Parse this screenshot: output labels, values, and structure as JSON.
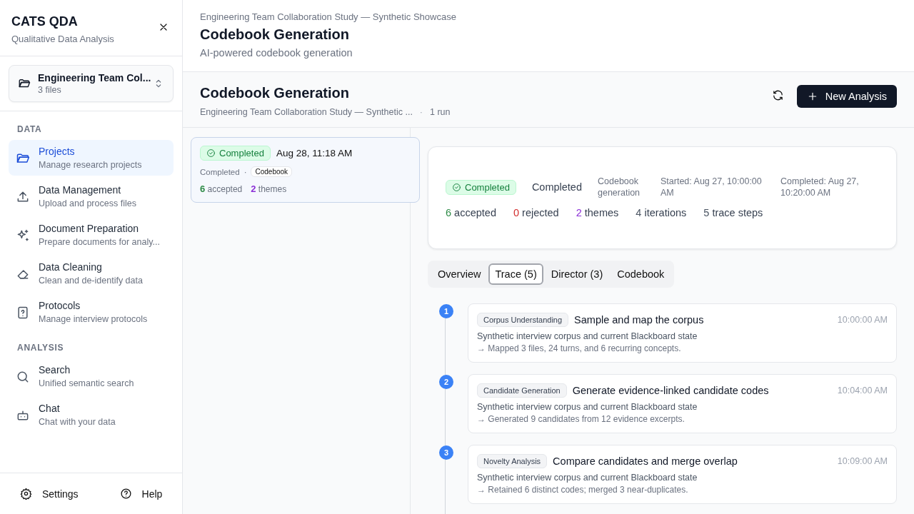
{
  "sidebar": {
    "app_title": "CATS QDA",
    "app_subtitle": "Qualitative Data Analysis",
    "project_picker": {
      "name": "Engineering Team Col...",
      "files": "3 files"
    },
    "sections": [
      {
        "heading": "DATA",
        "items": [
          {
            "label": "Projects",
            "description": "Manage research projects",
            "selected": true
          },
          {
            "label": "Data Management",
            "description": "Upload and process files",
            "selected": false
          },
          {
            "label": "Document Preparation",
            "description": "Prepare documents for analy...",
            "selected": false
          },
          {
            "label": "Data Cleaning",
            "description": "Clean and de-identify data",
            "selected": false
          },
          {
            "label": "Protocols",
            "description": "Manage interview protocols",
            "selected": false
          }
        ]
      },
      {
        "heading": "ANALYSIS",
        "items": [
          {
            "label": "Search",
            "description": "Unified semantic search",
            "selected": false
          },
          {
            "label": "Chat",
            "description": "Chat with your data",
            "selected": false
          }
        ]
      }
    ],
    "footer": [
      {
        "label": "Settings"
      },
      {
        "label": "Help"
      }
    ]
  },
  "header": {
    "breadcrumb": "Engineering Team Collaboration Study — Synthetic Showcase",
    "title": "Codebook Generation",
    "subtitle": "AI-powered codebook generation"
  },
  "toolbar": {
    "title": "Codebook Generation",
    "project": "Engineering Team Collaboration Study — Synthetic ...",
    "separator": "·",
    "runs": "1 run",
    "new_button": "New Analysis"
  },
  "runs": [
    {
      "status": "Completed",
      "date": "Aug 28, 11:18 AM",
      "state": "Completed",
      "separator": "·",
      "tag": "Codebook",
      "selected": true,
      "stats": [
        {
          "count": "6",
          "label": "accepted",
          "color": "#2e8b47"
        },
        {
          "count": "2",
          "label": "themes",
          "color": "#8b2fd6"
        }
      ]
    }
  ],
  "summary": {
    "status": "Completed",
    "state": "Completed",
    "kind_label": "Codebook generation",
    "started": "Started: Aug 27, 10:00:00 AM",
    "completed": "Completed: Aug 27, 10:20:00 AM",
    "stats": [
      {
        "count": "6",
        "label": "accepted",
        "color": "#2e8b47"
      },
      {
        "count": "0",
        "label": "rejected",
        "color": "#d32f2f"
      },
      {
        "count": "2",
        "label": "themes",
        "color": "#8b2fd6"
      },
      {
        "count": "4",
        "label": "iterations",
        "color": "#4b5563"
      },
      {
        "count": "5",
        "label": "trace steps",
        "color": "#4b5563"
      }
    ]
  },
  "tabs": [
    {
      "label": "Overview",
      "selected": false
    },
    {
      "label": "Trace (5)",
      "selected": true
    },
    {
      "label": "Director (3)",
      "selected": false
    },
    {
      "label": "Codebook",
      "selected": false
    }
  ],
  "trace": [
    {
      "number": "1",
      "phase": "Corpus Understanding",
      "title": "Sample and map the corpus",
      "time": "10:00:00 AM",
      "input": "Synthetic interview corpus and current Blackboard state",
      "output": "→ Mapped 3 files, 24 turns, and 6 recurring concepts."
    },
    {
      "number": "2",
      "phase": "Candidate Generation",
      "title": "Generate evidence-linked candidate codes",
      "time": "10:04:00 AM",
      "input": "Synthetic interview corpus and current Blackboard state",
      "output": "→ Generated 9 candidates from 12 evidence excerpts."
    },
    {
      "number": "3",
      "phase": "Novelty Analysis",
      "title": "Compare candidates and merge overlap",
      "time": "10:09:00 AM",
      "input": "Synthetic interview corpus and current Blackboard state",
      "output": "→ Retained 6 distinct codes; merged 3 near-duplicates."
    }
  ]
}
